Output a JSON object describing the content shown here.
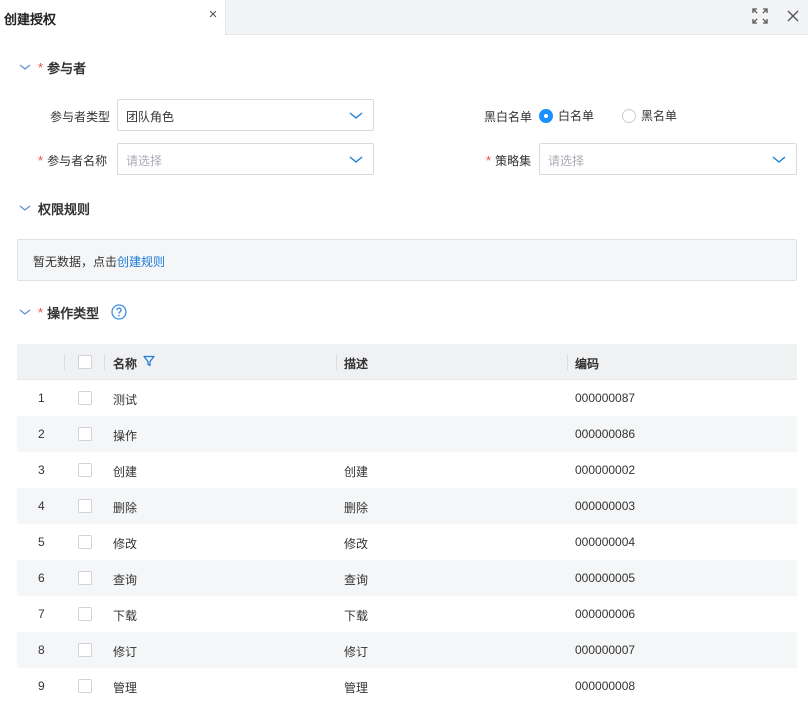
{
  "tab": {
    "title": "创建授权",
    "close": "×"
  },
  "sections": {
    "participants": {
      "title": "参与者",
      "required": "*"
    },
    "rules": {
      "title": "权限规则"
    },
    "operations": {
      "title": "操作类型",
      "required": "*"
    }
  },
  "participant_form": {
    "type_label": "参与者类型",
    "type_value": "团队角色",
    "name_label": "参与者名称",
    "name_required": "*",
    "name_placeholder": "请选择",
    "list_label": "黑白名单",
    "whitelist_label": "白名单",
    "blacklist_label": "黑名单",
    "list_selected": "白名单",
    "policy_label": "策略集",
    "policy_required": "*",
    "policy_placeholder": "请选择"
  },
  "rules_empty": {
    "text": "暂无数据，点击",
    "link": "创建规则"
  },
  "table": {
    "headers": {
      "name": "名称",
      "desc": "描述",
      "code": "编码"
    },
    "rows": [
      {
        "no": "1",
        "name": "测试",
        "desc": "",
        "code": "000000087"
      },
      {
        "no": "2",
        "name": "操作",
        "desc": "",
        "code": "000000086"
      },
      {
        "no": "3",
        "name": "创建",
        "desc": "创建",
        "code": "000000002"
      },
      {
        "no": "4",
        "name": "删除",
        "desc": "删除",
        "code": "000000003"
      },
      {
        "no": "5",
        "name": "修改",
        "desc": "修改",
        "code": "000000004"
      },
      {
        "no": "6",
        "name": "查询",
        "desc": "查询",
        "code": "000000005"
      },
      {
        "no": "7",
        "name": "下载",
        "desc": "下载",
        "code": "000000006"
      },
      {
        "no": "8",
        "name": "修订",
        "desc": "修订",
        "code": "000000007"
      },
      {
        "no": "9",
        "name": "管理",
        "desc": "管理",
        "code": "000000008"
      }
    ]
  },
  "colors": {
    "accent": "#1890ff",
    "required": "#f04a3e",
    "link": "#1a7bd9"
  },
  "icons": [
    "close-icon",
    "fullscreen-icon",
    "window-close-icon",
    "chevron-down-icon",
    "help-circle-icon",
    "filter-icon"
  ]
}
